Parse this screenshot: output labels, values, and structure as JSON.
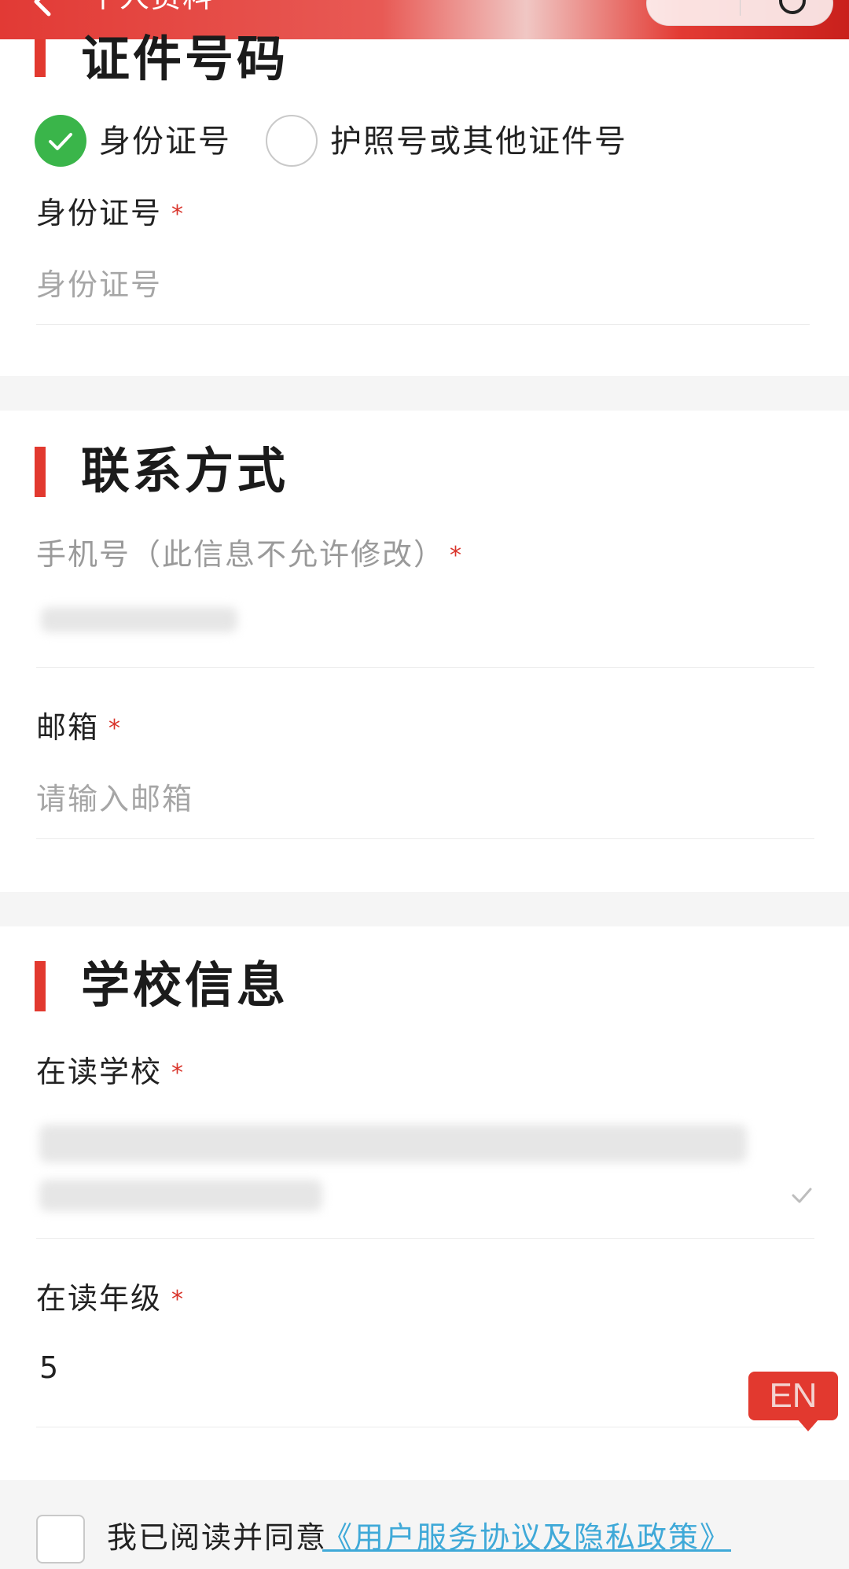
{
  "header": {
    "title": "个人资料"
  },
  "id_section": {
    "title": "证件号码",
    "options": [
      {
        "label": "身份证号",
        "selected": true
      },
      {
        "label": "护照号或其他证件号",
        "selected": false
      }
    ],
    "field_label": "身份证号",
    "field_placeholder": "身份证号",
    "required_mark": "*"
  },
  "contact_section": {
    "title": "联系方式",
    "phone_label": "手机号（此信息不允许修改）",
    "email_label": "邮箱",
    "email_placeholder": "请输入邮箱",
    "required_mark": "*"
  },
  "school_section": {
    "title": "学校信息",
    "school_label": "在读学校",
    "grade_label": "在读年级",
    "grade_value": "5",
    "required_mark": "*"
  },
  "language_toggle": "EN",
  "agreement": {
    "text": "我已阅读并同意",
    "link": "《用户服务协议及隐私政策》"
  },
  "colors": {
    "accent_red": "#e2392f",
    "check_green": "#3ab54a",
    "link_blue": "#3fa9d8"
  },
  "icons": {
    "back": "chevron-left-icon",
    "checked": "check-icon",
    "dropdown": "check-small-icon"
  }
}
